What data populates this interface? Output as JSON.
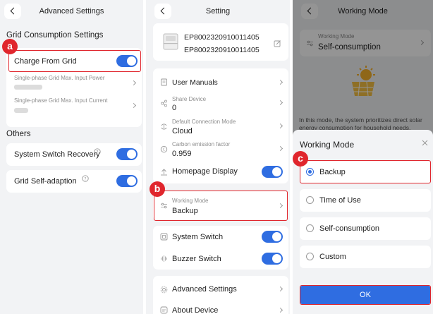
{
  "advanced": {
    "title": "Advanced Settings",
    "grid_section": "Grid Consumption Settings",
    "charge_from_grid": "Charge From Grid",
    "power_label": "Single-phase Grid Max. Input Power",
    "current_label": "Single-phase Grid Max. Input Current",
    "others_section": "Others",
    "system_switch_recovery": "System Switch Recovery",
    "grid_self_adaption": "Grid Self-adaption"
  },
  "setting": {
    "title": "Setting",
    "device_sn": "EP8002320910011405",
    "device_sn_2": "EP8002320910011405",
    "user_manuals": "User Manuals",
    "share_device_label": "Share Device",
    "share_device_value": "0",
    "connection_mode_label": "Default Connection Mode",
    "connection_mode_value": "Cloud",
    "carbon_label": "Carbon emission factor",
    "carbon_value": "0.959",
    "homepage_display": "Homepage Display",
    "working_mode_label": "Working Mode",
    "working_mode_value": "Backup",
    "system_switch": "System Switch",
    "buzzer_switch": "Buzzer Switch",
    "advanced_settings": "Advanced Settings",
    "about_device": "About Device"
  },
  "working": {
    "title": "Working Mode",
    "mode_label": "Working Mode",
    "mode_value": "Self-consumption",
    "description": "In this mode, the system prioritizes direct solar energy consumption for household needs.",
    "sheet_title": "Working Mode",
    "options": [
      "Backup",
      "Time of Use",
      "Self-consumption",
      "Custom"
    ],
    "selected": "Backup",
    "ok": "OK"
  },
  "badges": {
    "a": "a",
    "b": "b",
    "c": "c"
  },
  "colors": {
    "accent": "#2f6de1",
    "highlight": "#e0262d",
    "background": "#f2f3f5"
  }
}
